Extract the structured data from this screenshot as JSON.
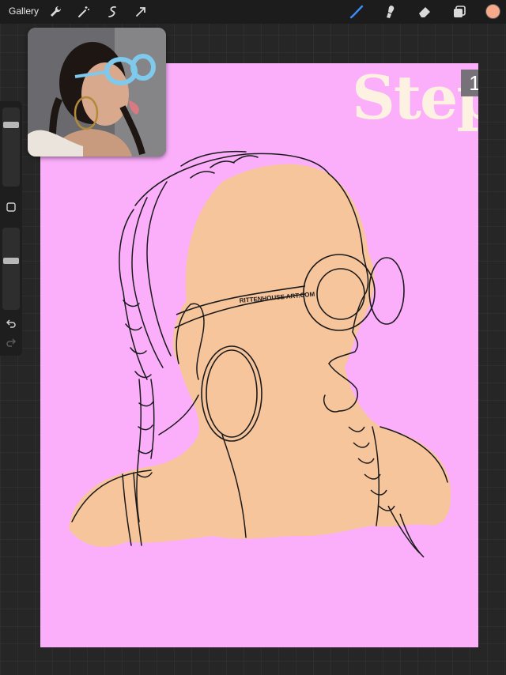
{
  "topbar": {
    "gallery_label": "Gallery",
    "tools_left": [
      "wrench-icon",
      "magic-wand-icon",
      "selection-icon",
      "transform-arrow-icon"
    ],
    "tools_right": [
      "brush-icon",
      "smudge-icon",
      "eraser-icon",
      "layers-icon"
    ],
    "current_color": "#f7a98c",
    "accent_color": "#3f8cff"
  },
  "sidebar": {
    "square_button": "modify-square-icon",
    "undo_button": "undo-arrow-icon",
    "redo_button": "redo-arrow-icon",
    "brush_size_level": 0.2,
    "opacity_level": 0.4
  },
  "canvas": {
    "background_color": "#fbaffb",
    "skin_color": "#f7c59c",
    "step_label": "Step",
    "step_number": "1",
    "watermark": "RITTENHOUSE ART.COM"
  }
}
